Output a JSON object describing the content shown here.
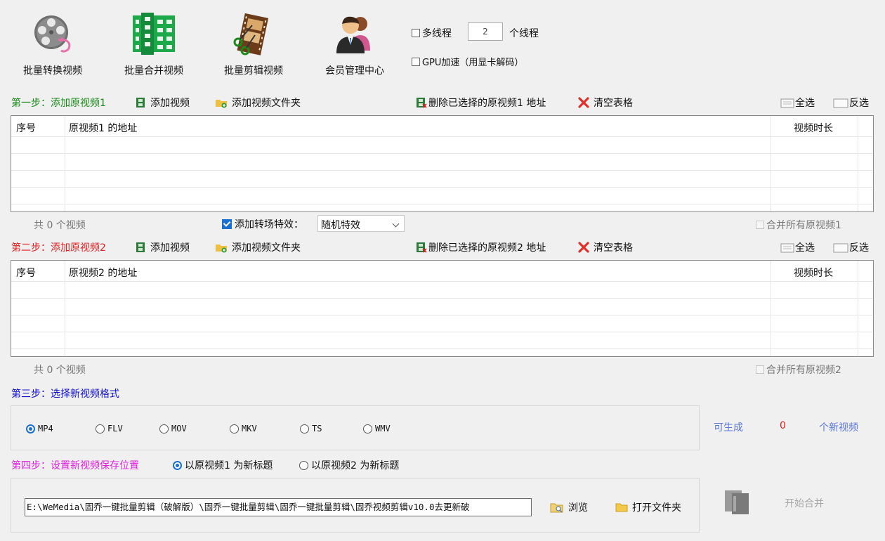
{
  "toolbar": {
    "batch_convert": "批量转换视频",
    "batch_merge": "批量合并视频",
    "batch_cut": "批量剪辑视频",
    "member_center": "会员管理中心"
  },
  "options": {
    "multithread_label": "多线程",
    "thread_count": "2",
    "thread_unit": "个线程",
    "gpu_label": "GPU加速（用显卡解码）"
  },
  "step1": {
    "label": "第一步：添加原视频1",
    "add_video": "添加视频",
    "add_folder": "添加视频文件夹",
    "delete_selected": "删除已选择的原视频1 地址",
    "clear_table": "清空表格",
    "select_all": "全选",
    "invert": "反选",
    "col_index": "序号",
    "col_path": "原视频1 的地址",
    "col_duration": "视频时长",
    "count": "共 0 个视频",
    "transition_label": "添加转场特效：",
    "transition_value": "随机特效",
    "merge_all": "合并所有原视频1"
  },
  "step2": {
    "label": "第二步：添加原视频2",
    "add_video": "添加视频",
    "add_folder": "添加视频文件夹",
    "delete_selected": "删除已选择的原视频2 地址",
    "clear_table": "清空表格",
    "select_all": "全选",
    "invert": "反选",
    "col_index": "序号",
    "col_path": "原视频2 的地址",
    "col_duration": "视频时长",
    "count": "共 0 个视频",
    "merge_all": "合并所有原视频2"
  },
  "step3": {
    "label": "第三步：选择新视频格式",
    "formats": [
      "MP4",
      "FLV",
      "MOV",
      "MKV",
      "TS",
      "WMV"
    ],
    "selected": "MP4",
    "can_generate": "可生成",
    "generate_count": "0",
    "new_videos": "个新视频"
  },
  "step4": {
    "label": "第四步：设置新视频保存位置",
    "title_opt1": "以原视频1 为新标题",
    "title_opt2": "以原视频2 为新标题",
    "save_path": "E:\\WeMedia\\固乔一键批量剪辑（破解版）\\固乔一键批量剪辑\\固乔一键批量剪辑\\固乔视频剪辑v10.0去更新破",
    "browse": "浏览",
    "open_folder": "打开文件夹",
    "start_merge": "开始合并"
  },
  "colors": {
    "step1": "#1a8a1a",
    "step2": "#e02020",
    "step3": "#1010d0",
    "step4": "#e020e0",
    "accent": "#1b6fd1",
    "generate_label": "#5b78d6",
    "generate_count": "#e02020"
  }
}
